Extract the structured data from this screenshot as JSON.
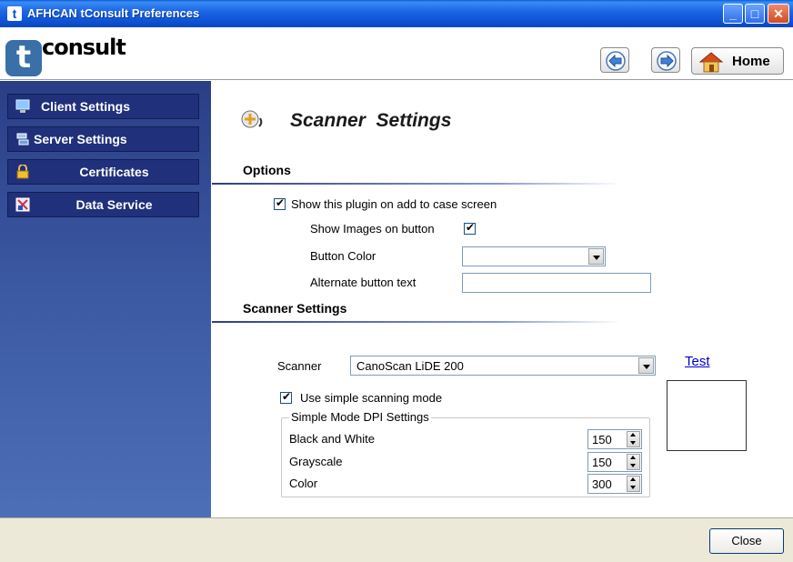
{
  "window": {
    "title": "AFHCAN tConsult Preferences",
    "app_icon_glyph": "t",
    "controls": [
      "minimize-icon",
      "maximize-icon",
      "close-icon"
    ]
  },
  "header": {
    "logo_glyph": "t",
    "logo_text": "consult",
    "back_icon": "arrow-left-icon",
    "forward_icon": "arrow-right-icon",
    "home_label": "Home"
  },
  "sidebar": {
    "items": [
      {
        "label": "Client Settings",
        "icon": "monitor-icon"
      },
      {
        "label": "Server Settings",
        "icon": "server-icon"
      },
      {
        "label": "Certificates",
        "icon": "lock-icon"
      },
      {
        "label": "Data Service",
        "icon": "data-service-icon"
      }
    ]
  },
  "main": {
    "title": "Scanner  Settings",
    "options_section": {
      "title": "Options",
      "show_plugin_label": "Show this plugin on add to case screen",
      "show_plugin_checked": true,
      "show_images_label": "Show Images on button",
      "show_images_checked": true,
      "button_color_label": "Button Color",
      "button_color_value": "",
      "alt_text_label": "Alternate button text",
      "alt_text_value": ""
    },
    "scanner_section": {
      "title": "Scanner Settings",
      "scanner_label": "Scanner",
      "scanner_value": "CanoScan LiDE 200",
      "test_link": "Test",
      "simple_mode_label": "Use simple scanning mode",
      "simple_mode_checked": true,
      "dpi_group": {
        "legend": "Simple Mode DPI Settings",
        "rows": [
          {
            "label": "Black and White",
            "value": "150"
          },
          {
            "label": "Grayscale",
            "value": "150"
          },
          {
            "label": "Color",
            "value": "300"
          }
        ]
      }
    }
  },
  "footer": {
    "close_label": "Close"
  },
  "colors": {
    "titlebar": "#0b4fcf",
    "sidebar": "#2a3e86",
    "sidebar_item": "#20307a",
    "link": "#0000cc",
    "footer": "#ece9d8"
  }
}
